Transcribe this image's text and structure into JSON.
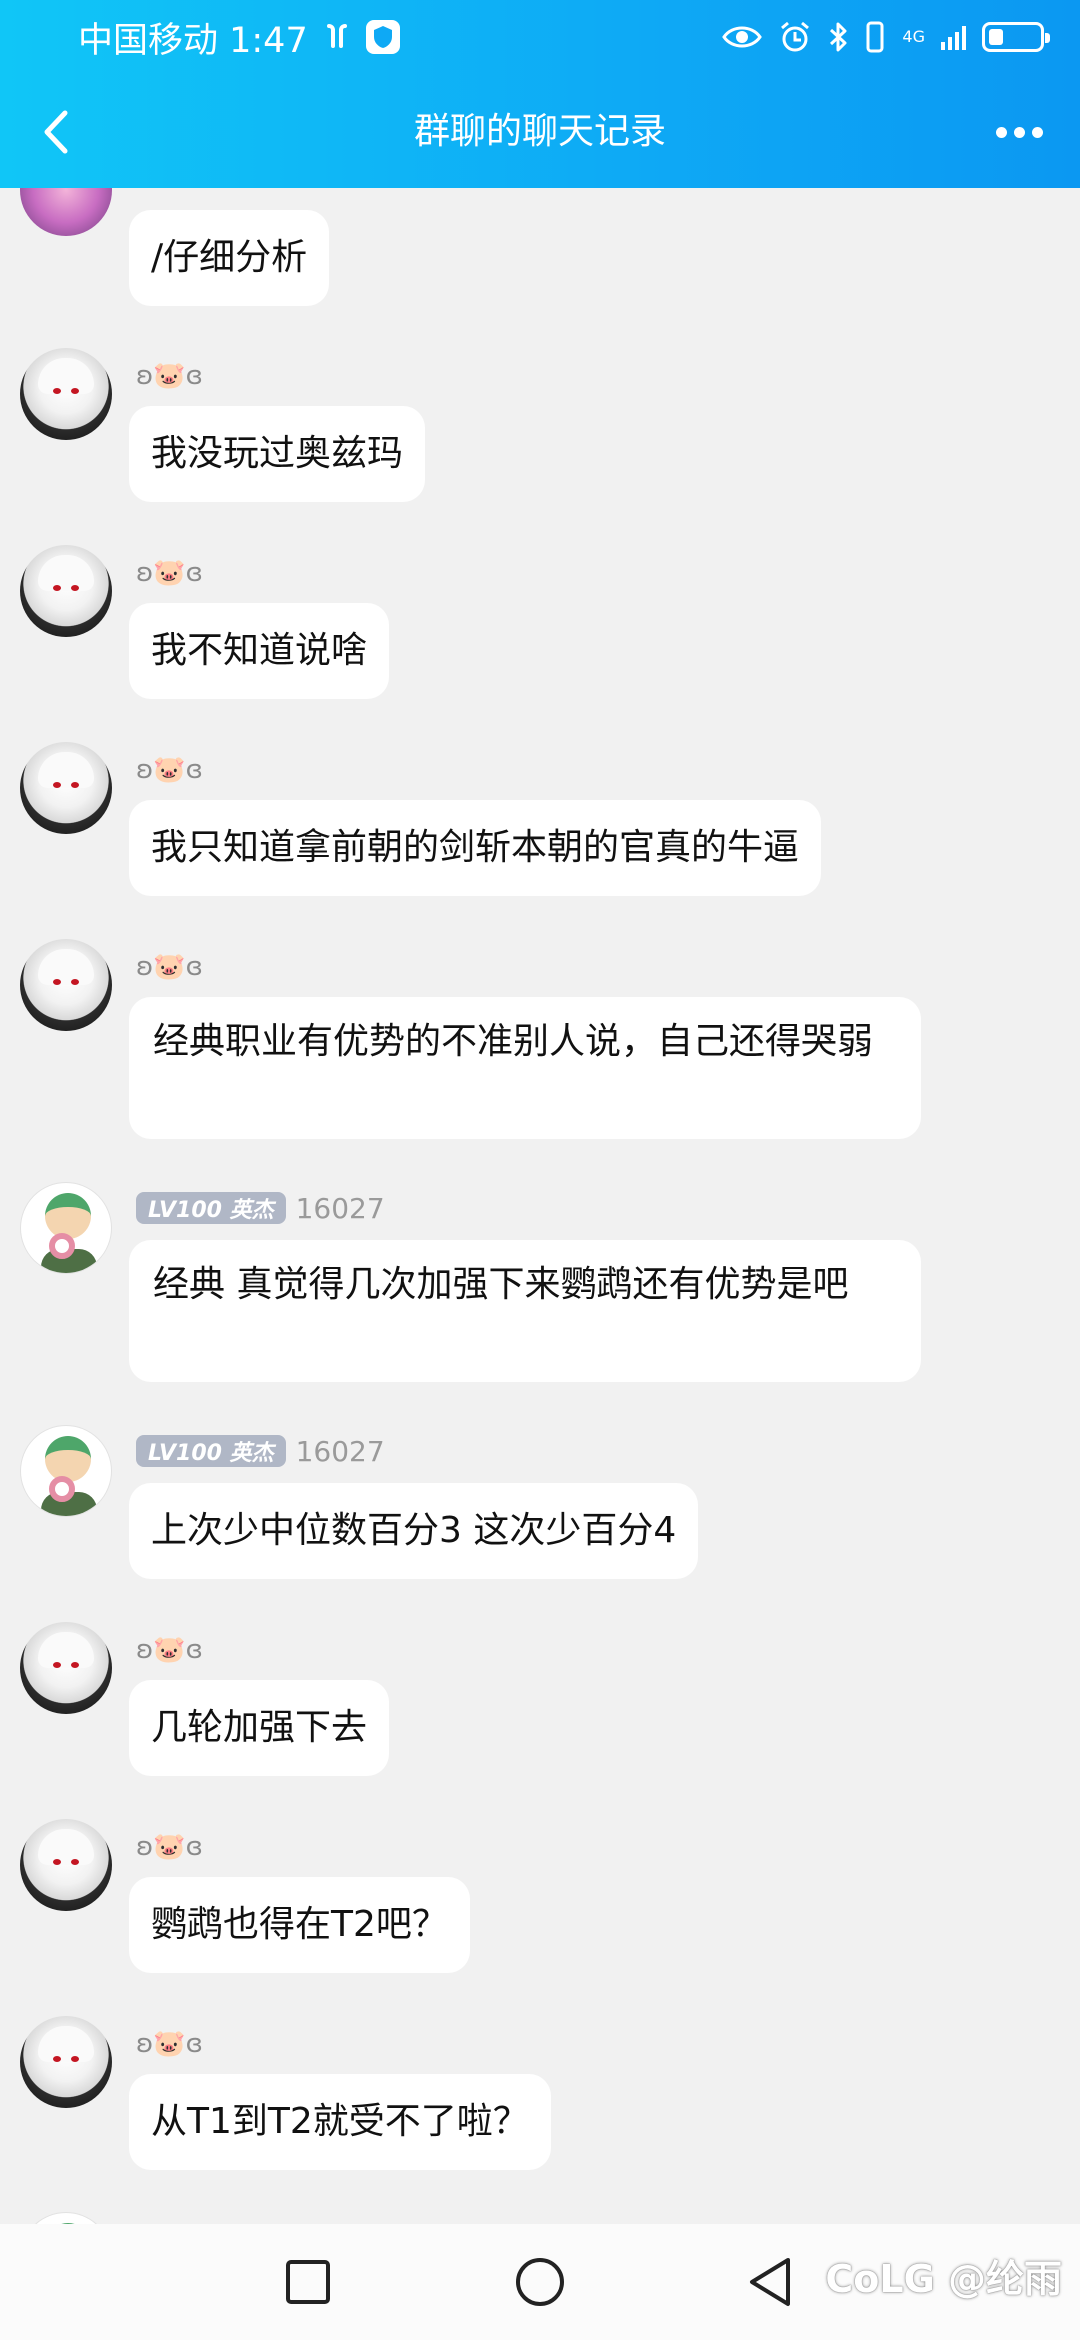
{
  "status_bar": {
    "carrier": "中国移动 1:47",
    "network": "4G"
  },
  "nav": {
    "title": "群聊的聊天记录"
  },
  "messages": [
    {
      "user": "",
      "kind": "top",
      "text": "/仔细分析"
    },
    {
      "user": "ʚ🐷ɞ",
      "kind": "girl",
      "text": "我没玩过奥兹玛"
    },
    {
      "user": "ʚ🐷ɞ",
      "kind": "girl",
      "text": "我不知道说啥"
    },
    {
      "user": "ʚ🐷ɞ",
      "kind": "girl",
      "text": "我只知道拿前朝的剑斩本朝的官真的牛逼"
    },
    {
      "user": "ʚ🐷ɞ",
      "kind": "girl",
      "text": "经典职业有优势的不准别人说，自己还得哭弱"
    },
    {
      "level_badge": "LV100 英杰",
      "uid": "16027",
      "kind": "toon",
      "text": "经典 真觉得几次加强下来鹦鹉还有优势是吧"
    },
    {
      "level_badge": "LV100 英杰",
      "uid": "16027",
      "kind": "toon",
      "text": "上次少中位数百分3 这次少百分4"
    },
    {
      "user": "ʚ🐷ɞ",
      "kind": "girl",
      "text": "几轮加强下去"
    },
    {
      "user": "ʚ🐷ɞ",
      "kind": "girl",
      "text": "鹦鹉也得在T2吧？"
    },
    {
      "user": "ʚ🐷ɞ",
      "kind": "girl",
      "text": "从T1到T2就受不了啦？"
    }
  ],
  "watermark": "CoLG @纶雨"
}
